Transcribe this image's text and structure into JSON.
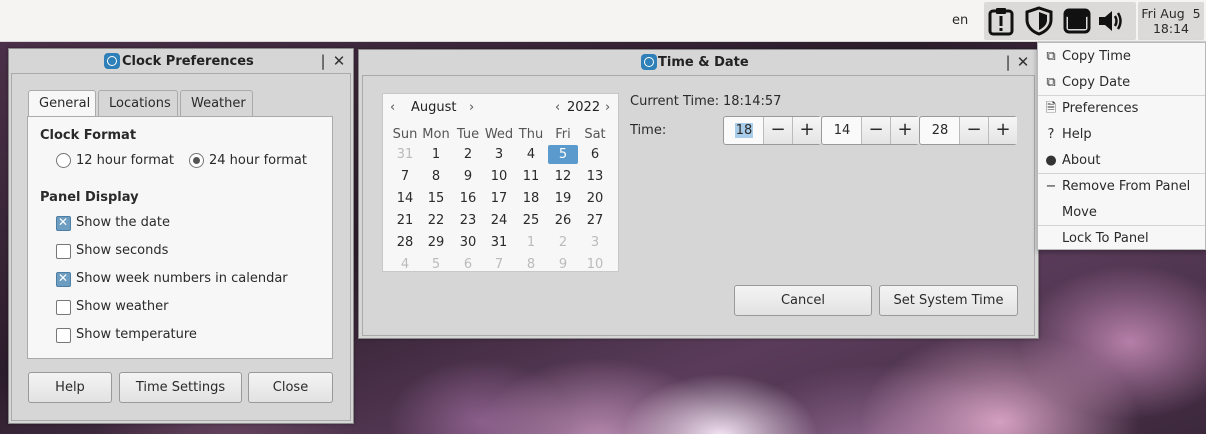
{
  "panel": {
    "keyboard_lang": "en",
    "clock_day": "Fri Aug  5",
    "clock_time": "18:14",
    "tray_icons": [
      "clipboard-alert-icon",
      "shield-icon",
      "window-icon",
      "volume-icon"
    ]
  },
  "clock_prefs": {
    "title": "Clock Preferences",
    "tabs": [
      "General",
      "Locations",
      "Weather"
    ],
    "clock_format_heading": "Clock Format",
    "format_12": "12 hour format",
    "format_24": "24 hour format",
    "selected_format": "24",
    "panel_display_heading": "Panel Display",
    "options": [
      {
        "label": "Show the date",
        "checked": true
      },
      {
        "label": "Show seconds",
        "checked": false
      },
      {
        "label": "Show week numbers in calendar",
        "checked": true
      },
      {
        "label": "Show weather",
        "checked": false
      },
      {
        "label": "Show temperature",
        "checked": false
      }
    ],
    "buttons": {
      "help": "Help",
      "time_settings": "Time Settings",
      "close": "Close"
    }
  },
  "time_date": {
    "title": "Time & Date",
    "calendar": {
      "month": "August",
      "year": "2022",
      "weekdays": [
        "Sun",
        "Mon",
        "Tue",
        "Wed",
        "Thu",
        "Fri",
        "Sat"
      ],
      "weeks": [
        [
          "31",
          "1",
          "2",
          "3",
          "4",
          "5",
          "6"
        ],
        [
          "7",
          "8",
          "9",
          "10",
          "11",
          "12",
          "13"
        ],
        [
          "14",
          "15",
          "16",
          "17",
          "18",
          "19",
          "20"
        ],
        [
          "21",
          "22",
          "23",
          "24",
          "25",
          "26",
          "27"
        ],
        [
          "28",
          "29",
          "30",
          "31",
          "1",
          "2",
          "3"
        ],
        [
          "4",
          "5",
          "6",
          "7",
          "8",
          "9",
          "10"
        ]
      ],
      "selected_day": "5"
    },
    "current_time_label": "Current Time:",
    "current_time_value": "18:14:57",
    "time_label": "Time:",
    "hours": "18",
    "minutes": "14",
    "seconds": "28",
    "buttons": {
      "cancel": "Cancel",
      "set_system_time": "Set System Time"
    }
  },
  "context_menu": {
    "items": [
      {
        "label": "Copy Time",
        "icon": "copy-icon"
      },
      {
        "label": "Copy Date",
        "icon": "copy-icon"
      },
      {
        "label": "Preferences",
        "icon": "preferences-icon"
      },
      {
        "label": "Help",
        "icon": "help-icon"
      },
      {
        "label": "About",
        "icon": "info-icon"
      },
      {
        "label": "Remove From Panel",
        "icon": "remove-icon"
      },
      {
        "label": "Move",
        "icon": ""
      },
      {
        "label": "Lock To Panel",
        "icon": ""
      }
    ]
  }
}
